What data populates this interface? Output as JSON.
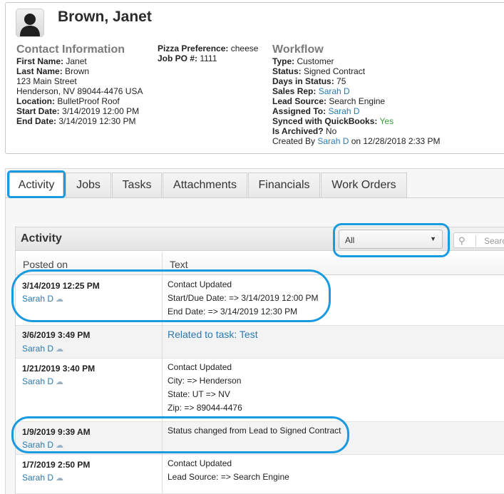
{
  "contact": {
    "name": "Brown, Janet",
    "section_title": "Contact Information",
    "first_name_label": "First Name:",
    "first_name": "Janet",
    "last_name_label": "Last Name:",
    "last_name": "Brown",
    "address_line1": "123 Main Street",
    "address_line2": "Henderson, NV 89044-4476 USA",
    "location_label": "Location:",
    "location": "BulletProof Roof",
    "start_date_label": "Start Date:",
    "start_date": "3/14/2019 12:00 PM",
    "end_date_label": "End Date:",
    "end_date": "3/14/2019 12:30 PM",
    "pizza_label": "Pizza Preference:",
    "pizza": "cheese",
    "job_po_label": "Job PO #:",
    "job_po": "1111"
  },
  "workflow": {
    "title": "Workflow",
    "type_label": "Type:",
    "type": "Customer",
    "status_label": "Status:",
    "status": "Signed Contract",
    "days_label": "Days in Status:",
    "days": "75",
    "sales_rep_label": "Sales Rep:",
    "sales_rep": "Sarah D",
    "lead_source_label": "Lead Source:",
    "lead_source": "Search Engine",
    "assigned_label": "Assigned To:",
    "assigned": "Sarah D",
    "synced_label": "Synced with QuickBooks:",
    "synced": "Yes",
    "archived_label": "Is Archived?",
    "archived": "No",
    "created_prefix": "Created By",
    "created_by": "Sarah D",
    "created_on": "on 12/28/2018 2:33 PM"
  },
  "tabs": [
    {
      "label": "Activity"
    },
    {
      "label": "Jobs"
    },
    {
      "label": "Tasks"
    },
    {
      "label": "Attachments"
    },
    {
      "label": "Financials"
    },
    {
      "label": "Work Orders"
    }
  ],
  "activity": {
    "title": "Activity",
    "filter_value": "All",
    "search_placeholder": "Search",
    "col_posted": "Posted on",
    "col_text": "Text",
    "rows": [
      {
        "date": "3/14/2019 12:25 PM",
        "user": "Sarah D",
        "lines": [
          "Contact Updated",
          "Start/Due Date: => 3/14/2019 12:00 PM",
          "End Date: => 3/14/2019 12:30 PM"
        ]
      },
      {
        "date": "3/6/2019 3:49 PM",
        "user": "Sarah D",
        "link": "Related to task: Test"
      },
      {
        "date": "1/21/2019 3:40 PM",
        "user": "Sarah D",
        "lines": [
          "Contact Updated",
          "City: => Henderson",
          "State: UT => NV",
          "Zip: => 89044-4476"
        ]
      },
      {
        "date": "1/9/2019 9:39 AM",
        "user": "Sarah D",
        "lines": [
          "Status changed from Lead to Signed Contract"
        ]
      },
      {
        "date": "1/7/2019 2:50 PM",
        "user": "Sarah D",
        "lines": [
          "Contact Updated",
          "Lead Source: => Search Engine"
        ]
      }
    ]
  },
  "colors": {
    "accent": "#1a9be0",
    "link": "#2a7ab0",
    "synced_yes": "#3a9a3a"
  }
}
